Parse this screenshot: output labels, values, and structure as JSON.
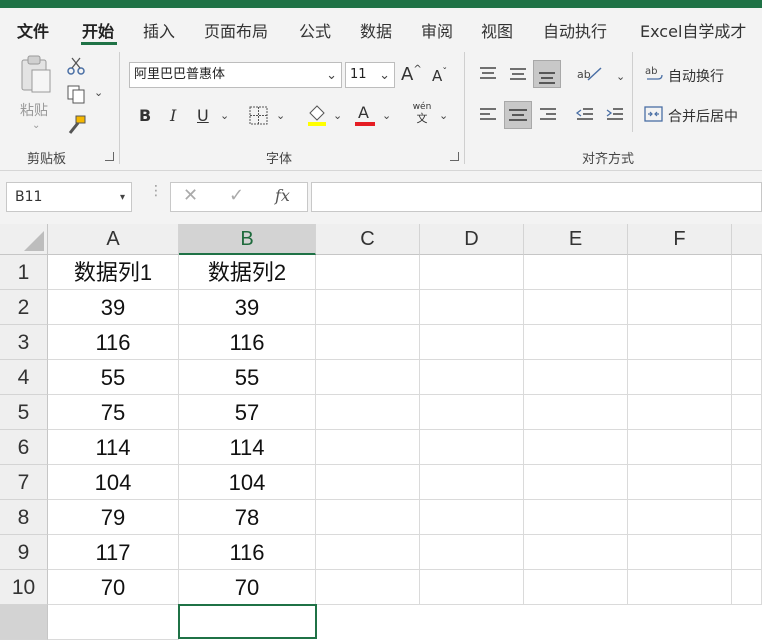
{
  "tabs": [
    "文件",
    "开始",
    "插入",
    "页面布局",
    "公式",
    "数据",
    "审阅",
    "视图",
    "自动执行",
    "Excel自学成才"
  ],
  "ribbon": {
    "clipboard": {
      "paste_label": "粘贴",
      "group_label": "剪贴板"
    },
    "font": {
      "font_name": "阿里巴巴普惠体",
      "font_size": "11",
      "bold": "B",
      "italic": "I",
      "underline": "U",
      "group_label": "字体",
      "grow_font": "A",
      "shrink_font": "A",
      "font_color_letter": "A",
      "phonetic_top": "wén",
      "phonetic_bottom": "文"
    },
    "alignment": {
      "wrap_text": "自动换行",
      "merge_center": "合并后居中",
      "group_label": "对齐方式"
    }
  },
  "formula_bar": {
    "name_box": "B11",
    "fx": "fx",
    "formula": ""
  },
  "sheet": {
    "columns": [
      "A",
      "B",
      "C",
      "D",
      "E",
      "F"
    ],
    "selected_column": "B",
    "rows": [
      {
        "num": "1",
        "a": "数据列1",
        "b": "数据列2"
      },
      {
        "num": "2",
        "a": "39",
        "b": "39"
      },
      {
        "num": "3",
        "a": "116",
        "b": "116"
      },
      {
        "num": "4",
        "a": "55",
        "b": "55"
      },
      {
        "num": "5",
        "a": "75",
        "b": "57"
      },
      {
        "num": "6",
        "a": "114",
        "b": "114"
      },
      {
        "num": "7",
        "a": "104",
        "b": "104"
      },
      {
        "num": "8",
        "a": "79",
        "b": "78"
      },
      {
        "num": "9",
        "a": "117",
        "b": "116"
      },
      {
        "num": "10",
        "a": "70",
        "b": "70"
      }
    ]
  },
  "colors": {
    "accent": "#1f7246",
    "font_color": "#e51c23",
    "highlight": "#ffff00"
  }
}
